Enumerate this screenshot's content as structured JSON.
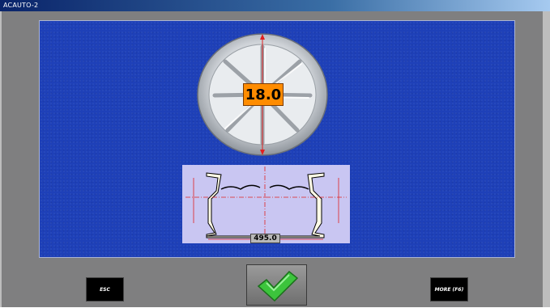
{
  "window": {
    "title": "ACAUTO-2"
  },
  "measurement": {
    "diameter": "18.0",
    "width": "495.0"
  },
  "buttons": {
    "esc_label": "ESC",
    "more_label": "MORE (F6)"
  },
  "colors": {
    "panel_blue": "#1e40b8",
    "badge_orange": "#ff8c00",
    "profile_lilac": "#c9c6f2",
    "check_green": "#3cc43c"
  },
  "icons": {
    "confirm": "checkmark-icon"
  }
}
